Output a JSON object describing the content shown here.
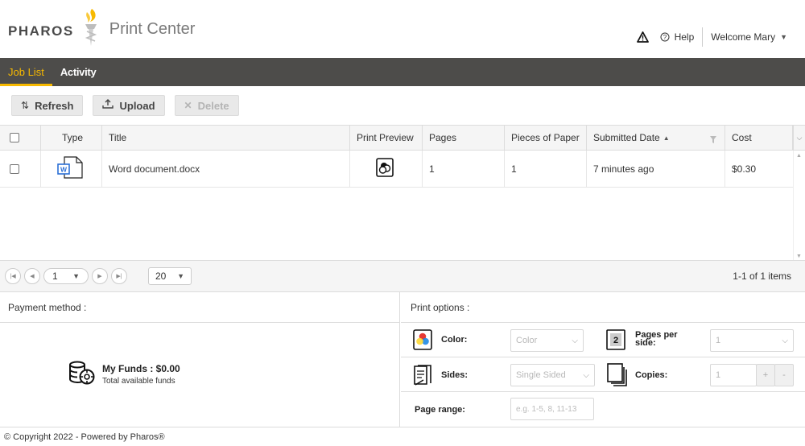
{
  "brand": {
    "logo_text": "PHAROS",
    "app_name": "Print Center"
  },
  "topbar": {
    "help_label": "Help",
    "welcome_label": "Welcome Mary"
  },
  "nav": {
    "tabs": [
      {
        "label": "Job List",
        "active": true
      },
      {
        "label": "Activity",
        "active": false
      }
    ]
  },
  "toolbar": {
    "refresh_label": "Refresh",
    "upload_label": "Upload",
    "delete_label": "Delete",
    "delete_disabled": true
  },
  "grid": {
    "columns": [
      "Type",
      "Title",
      "Print Preview",
      "Pages",
      "Pieces of Paper",
      "Submitted Date",
      "Cost"
    ],
    "sorted_column": "Submitted Date",
    "rows": [
      {
        "type_icon": "word-doc-icon",
        "title": "Word document.docx",
        "pages": "1",
        "pieces": "1",
        "submitted": "7 minutes ago",
        "cost": "$0.30"
      }
    ]
  },
  "pager": {
    "page": "1",
    "page_size": "20",
    "info": "1-1 of 1 items"
  },
  "payment": {
    "header": "Payment method :",
    "funds_title": "My Funds : $0.00",
    "funds_sub": "Total available funds"
  },
  "print_options": {
    "header": "Print options :",
    "color_label": "Color:",
    "color_value": "Color",
    "pps_label": "Pages per side:",
    "pps_value": "1",
    "sides_label": "Sides:",
    "sides_value": "Single Sided",
    "copies_label": "Copies:",
    "copies_value": "1",
    "range_label": "Page range:",
    "range_placeholder": "e.g. 1-5, 8, 11-13",
    "plus": "+",
    "minus": "-"
  },
  "footer": {
    "text": "© Copyright 2022 - Powered by Pharos®"
  },
  "colors": {
    "nav_bg": "#4d4c4a",
    "accent": "#f7b900"
  }
}
